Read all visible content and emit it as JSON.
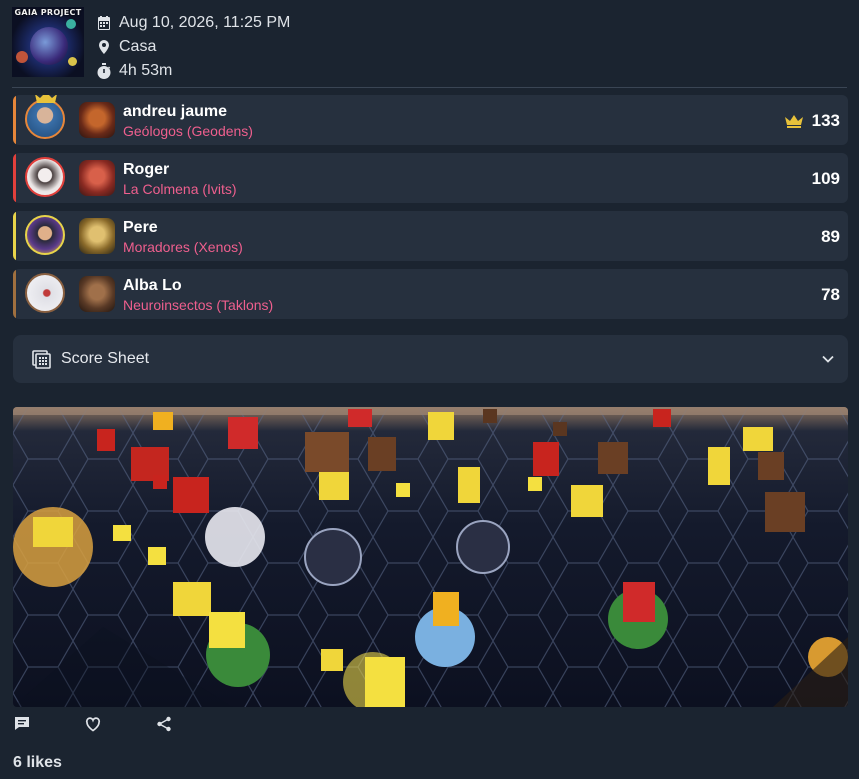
{
  "game": {
    "cover_title": "GAIA PROJECT"
  },
  "session": {
    "datetime": "Aug 10, 2026, 11:25 PM",
    "location": "Casa",
    "duration": "4h 53m"
  },
  "players": [
    {
      "name": "andreu jaume",
      "faction": "Geólogos (Geodens)",
      "score": "133",
      "winner": true,
      "color": "#e6863a",
      "avatar_color": "#3a6fa8",
      "faction_color": "#8a3a1e"
    },
    {
      "name": "Roger",
      "faction": "La Colmena (Ivits)",
      "score": "109",
      "winner": false,
      "color": "#e2403c",
      "avatar_color": "#e9e4e4",
      "faction_color": "#a8342c"
    },
    {
      "name": "Pere",
      "faction": "Moradores (Xenos)",
      "score": "89",
      "winner": false,
      "color": "#e8d44a",
      "avatar_color": "#5a3a8a",
      "faction_color": "#c9a24a"
    },
    {
      "name": "Alba Lo",
      "faction": "Neuroinsectos (Taklons)",
      "score": "78",
      "winner": false,
      "color": "#a0703f",
      "avatar_color": "#f1f1f4",
      "faction_color": "#6b4a32"
    }
  ],
  "score_sheet": {
    "label": "Score Sheet"
  },
  "social": {
    "likes_text": "6 likes"
  },
  "icons": {
    "calendar": "calendar-icon",
    "location": "map-pin-icon",
    "duration": "stopwatch-icon",
    "winner": "crown-icon",
    "score_sheet": "calculator-icon",
    "expand": "chevron-down-icon",
    "comment": "comment-icon",
    "like": "heart-icon",
    "share": "share-icon"
  },
  "colors": {
    "background": "#1b2430",
    "card": "#26303e",
    "faction_text": "#ef5f8e",
    "crown": "#e8c23a"
  }
}
